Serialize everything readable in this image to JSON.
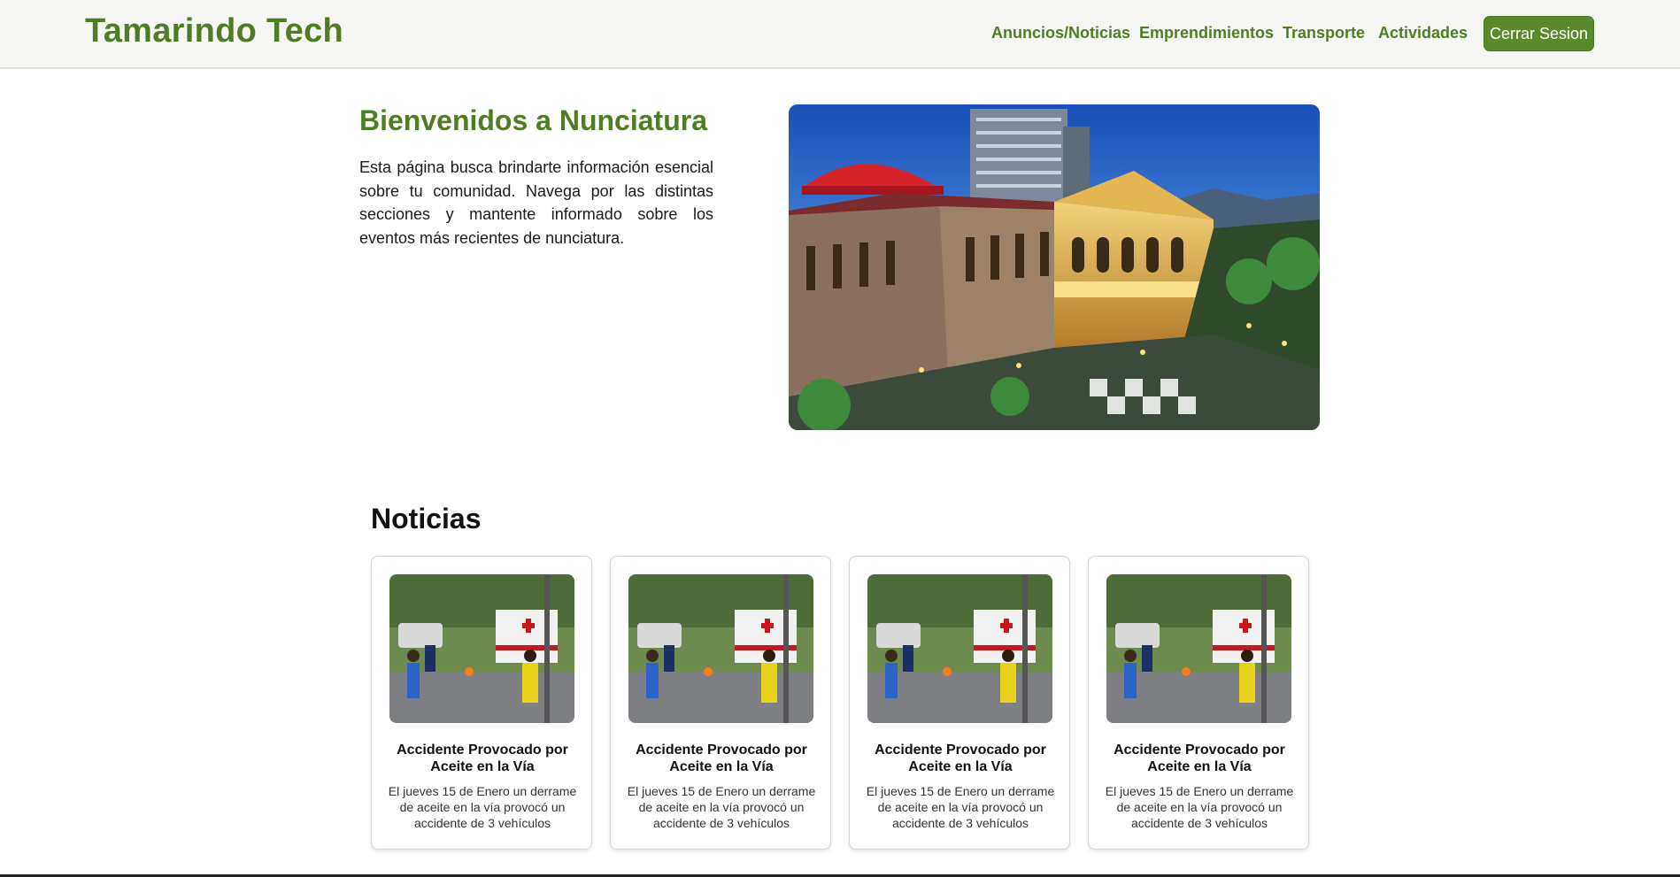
{
  "navbar": {
    "brand": "Tamarindo Tech",
    "links": [
      "Anuncios/Noticias",
      "Emprendimientos",
      "Transporte",
      "Actividades"
    ],
    "logout_label": "Cerrar Sesion"
  },
  "hero": {
    "title": "Bienvenidos a Nunciatura",
    "text": "Esta página busca brindarte información esencial sobre tu comunidad. Navega por las distintas secciones y mantente informado sobre los eventos más recientes de nunciatura."
  },
  "news": {
    "title": "Noticias",
    "cards": [
      {
        "title": "Accidente Provocado por Aceite en la Vía",
        "text": "El jueves 15 de Enero un derrame de aceite en la vía provocó un accidente de 3 vehículos"
      },
      {
        "title": "Accidente Provocado por Aceite en la Vía",
        "text": "El jueves 15 de Enero un derrame de aceite en la vía provocó un accidente de 3 vehículos"
      },
      {
        "title": "Accidente Provocado por Aceite en la Vía",
        "text": "El jueves 15 de Enero un derrame de aceite en la vía provocó un accidente de 3 vehículos"
      },
      {
        "title": "Accidente Provocado por Aceite en la Vía",
        "text": "El jueves 15 de Enero un derrame de aceite en la vía provocó un accidente de 3 vehículos"
      }
    ]
  },
  "colors": {
    "brand": "#4f7e22",
    "button": "#5a8a2c",
    "navbar_bg": "#f6f6f4"
  }
}
